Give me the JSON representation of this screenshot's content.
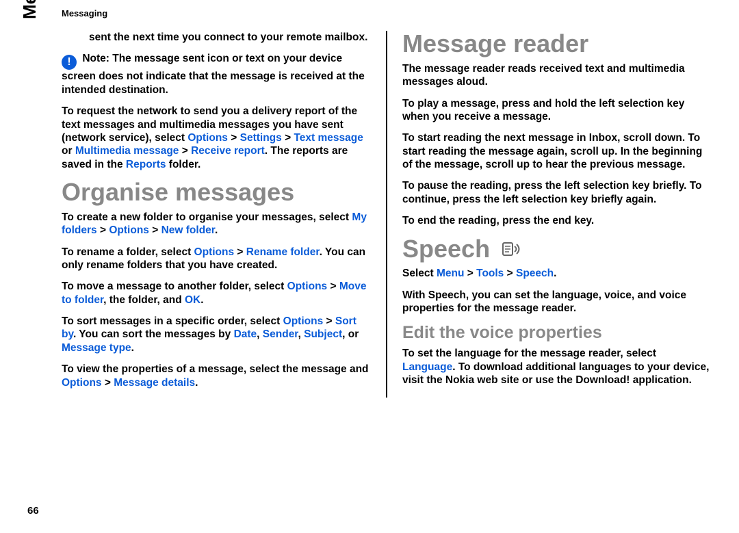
{
  "header": {
    "running": "Messaging",
    "side_tab": "Messaging",
    "page_number": "66"
  },
  "left": {
    "p_sent": "sent the next time you connect to your remote mailbox.",
    "note_label": "Note:",
    "p_note": "The message sent icon or text on your device screen does not indicate that the message is received at the intended destination.",
    "p_report_a": "To request the network to send you a delivery report of the text messages and multimedia messages you have sent (network service), select ",
    "kw_options": "Options",
    "gt": " > ",
    "kw_settings": "Settings",
    "kw_text_message": "Text message",
    "or": " or ",
    "kw_mm_message": "Multimedia message",
    "kw_receive_report": "Receive report",
    "p_report_b": ". The reports are saved in the ",
    "kw_reports": "Reports",
    "p_report_c": " folder.",
    "h_organise": "Organise messages",
    "p_org_a": "To create a new folder to organise your messages, select ",
    "kw_myfolders": "My folders",
    "kw_newfolder": "New folder",
    "p_org_b": ".",
    "p_rename_a": "To rename a folder, select ",
    "kw_rename": "Rename folder",
    "p_rename_b": ". You can only rename folders that you have created.",
    "p_move_a": "To move a message to another folder, select ",
    "kw_move": "Move to folder",
    "p_move_b": ", the folder, and ",
    "kw_ok": "OK",
    "p_move_c": ".",
    "p_sort_a": "To sort messages in a specific order, select ",
    "kw_sortby": "Sort by",
    "p_sort_b": ". You can sort the messages by ",
    "kw_date": "Date",
    "kw_sender": "Sender",
    "kw_subject": "Subject",
    "comma_or": ", or ",
    "kw_msgtype": "Message type",
    "p_sort_c": ".",
    "p_view_a": "To view the properties of a message, select the message and ",
    "kw_msgdetails": "Message details",
    "p_view_b": "."
  },
  "right": {
    "h_reader": "Message reader",
    "p_reader_intro": "The message reader reads received text and multimedia messages aloud.",
    "p_play": "To play a message, press and hold the left selection key when you receive a message.",
    "p_scroll": "To start reading the next message in Inbox, scroll down. To start reading the message again, scroll up. In the beginning of the message, scroll up to hear the previous message.",
    "p_pause": "To pause the reading, press the left selection key briefly. To continue, press the left selection key briefly again.",
    "p_end": "To end the reading, press the end key.",
    "h_speech": "Speech",
    "p_select_a": "Select ",
    "kw_menu": "Menu",
    "kw_tools": "Tools",
    "kw_speech": "Speech",
    "p_select_b": ".",
    "p_speech_desc": "With Speech, you can set the language, voice, and voice properties for the message reader.",
    "h_edit_voice": "Edit the voice properties",
    "p_lang_a": "To set the language for the message reader, select ",
    "kw_language": "Language",
    "p_lang_b": ". To download additional languages to your device, visit the Nokia web site or use the Download! application."
  }
}
